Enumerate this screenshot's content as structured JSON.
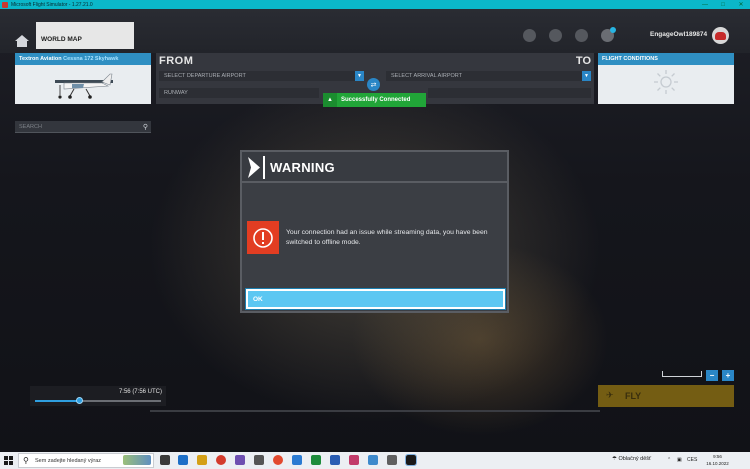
{
  "window": {
    "title": "Microsoft Flight Simulator - 1.27.21.0"
  },
  "topbar": {
    "tab_label": "WORLD MAP",
    "username": "EngageOwl189874"
  },
  "aircraft": {
    "maker": "Textron Aviation",
    "model": "Cessna 172 Skyhawk"
  },
  "route": {
    "from_label": "FROM",
    "to_label": "TO",
    "departure_placeholder": "SELECT DEPARTURE AIRPORT",
    "arrival_placeholder": "SELECT ARRIVAL AIRPORT",
    "runway_label": "RUNWAY"
  },
  "conditions": {
    "title": "FLIGHT CONDITIONS"
  },
  "toast": {
    "text": "Successfully Connected"
  },
  "search": {
    "placeholder": "SEARCH"
  },
  "dialog": {
    "title": "WARNING",
    "message": "Your connection had an issue while streaming data, you have been switched to offline mode.",
    "ok_label": "OK"
  },
  "timeline": {
    "time": "7:56 (7:56 UTC)",
    "progress": 0.35
  },
  "fly_button": {
    "label": "FLY"
  },
  "taskbar": {
    "search_placeholder": "Sem zadejte hledaný výraz",
    "weather": "Oblačný děšť",
    "lang": "CES",
    "clock_time": "9:56",
    "clock_date": "16.10.2022"
  },
  "colors": {
    "accent": "#2a86c6",
    "warning_red": "#e23d22",
    "ok_button": "#5cc7f2",
    "toast_green": "#21a538",
    "titlebar": "#0bb7c9"
  }
}
